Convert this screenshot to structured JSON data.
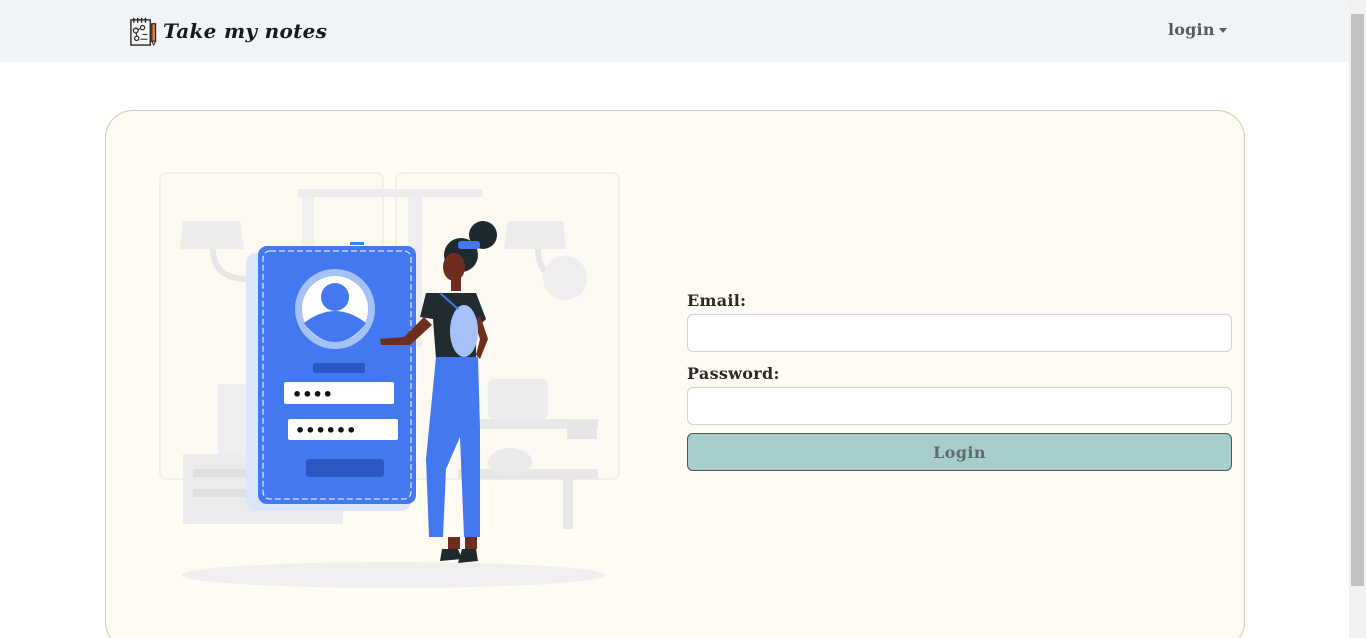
{
  "navbar": {
    "brand": "Take my notes",
    "login_menu": "login"
  },
  "form": {
    "email_label": "Email:",
    "email_value": "",
    "password_label": "Password:",
    "password_value": "",
    "submit_label": "Login"
  },
  "illustration": {
    "email_mask": "••••",
    "password_mask": "••••••"
  },
  "colors": {
    "navbar_bg": "#f1f5f7",
    "card_bg": "#fdfbf2",
    "button_bg": "#a8cdcd",
    "illustration_accent": "#4378f0"
  },
  "icons": {
    "brand": "notebook-icon",
    "dropdown": "caret-down-icon"
  }
}
